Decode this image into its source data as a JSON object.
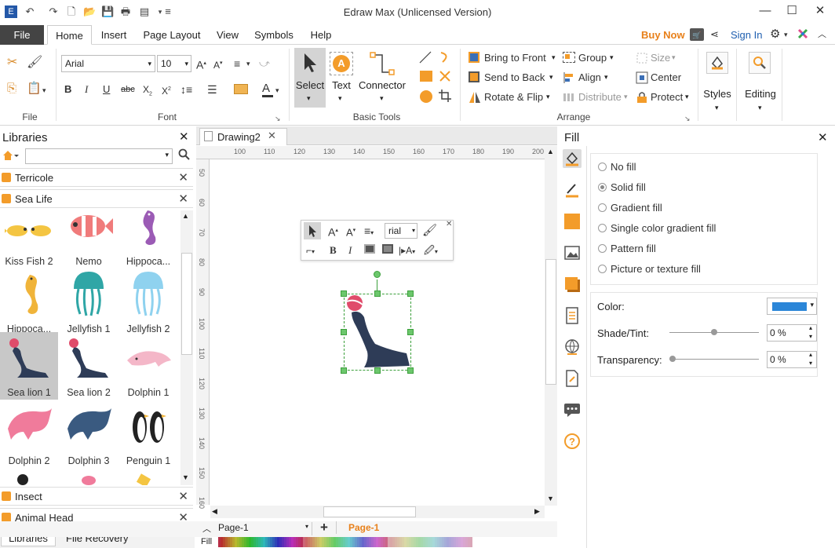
{
  "window": {
    "title": "Edraw Max (Unlicensed Version)"
  },
  "menu": {
    "file": "File",
    "tabs": [
      "Home",
      "Insert",
      "Page Layout",
      "View",
      "Symbols",
      "Help"
    ],
    "buy_now": "Buy Now",
    "sign_in": "Sign In"
  },
  "ribbon": {
    "groups": {
      "file": "File",
      "font": "Font",
      "basic_tools": "Basic Tools",
      "arrange": "Arrange"
    },
    "font_name": "Arial",
    "font_size": "10",
    "tools": {
      "select": "Select",
      "text": "Text",
      "connector": "Connector"
    },
    "arrange": {
      "bring_to_front": "Bring to Front",
      "send_to_back": "Send to Back",
      "rotate_flip": "Rotate & Flip",
      "group": "Group",
      "align": "Align",
      "distribute": "Distribute",
      "size": "Size",
      "center": "Center",
      "protect": "Protect"
    },
    "styles": "Styles",
    "editing": "Editing"
  },
  "libraries": {
    "title": "Libraries",
    "categories": [
      {
        "name": "Terricole"
      },
      {
        "name": "Sea Life"
      }
    ],
    "items": [
      "Kiss Fish 2",
      "Nemo",
      "Hippoca...",
      "Hippoca...",
      "Jellyfish 1",
      "Jellyfish 2",
      "Sea lion 1",
      "Sea lion 2",
      "Dolphin 1",
      "Dolphin 2",
      "Dolphin 3",
      "Penguin 1"
    ],
    "bottom_categories": [
      {
        "name": "Insect"
      },
      {
        "name": "Animal Head"
      }
    ],
    "tabs": {
      "libraries": "Libraries",
      "file_recovery": "File Recovery"
    }
  },
  "canvas": {
    "doc_tab": "Drawing2",
    "hruler": [
      "100",
      "110",
      "120",
      "130",
      "140",
      "150",
      "160",
      "170",
      "180",
      "190",
      "200"
    ],
    "vruler": [
      "50",
      "60",
      "70",
      "80",
      "90",
      "100",
      "110",
      "120",
      "130",
      "140",
      "150",
      "160"
    ],
    "mini_font": "rial",
    "page_select": "Page-1",
    "page_tab": "Page-1",
    "fill_label": "Fill"
  },
  "fill": {
    "title": "Fill",
    "options": [
      {
        "label": "No fill",
        "selected": false
      },
      {
        "label": "Solid fill",
        "selected": true
      },
      {
        "label": "Gradient fill",
        "selected": false
      },
      {
        "label": "Single color gradient fill",
        "selected": false
      },
      {
        "label": "Pattern fill",
        "selected": false
      },
      {
        "label": "Picture or texture fill",
        "selected": false
      }
    ],
    "color_label": "Color:",
    "color_value": "#2b86d8",
    "shade_label": "Shade/Tint:",
    "shade_value": "0 %",
    "transparency_label": "Transparency:",
    "transparency_value": "0 %"
  },
  "colors": {
    "accent_orange": "#f39c2a",
    "file_bg": "#444444",
    "buy_now": "#e8801a",
    "page_tab": "#e8801a"
  }
}
